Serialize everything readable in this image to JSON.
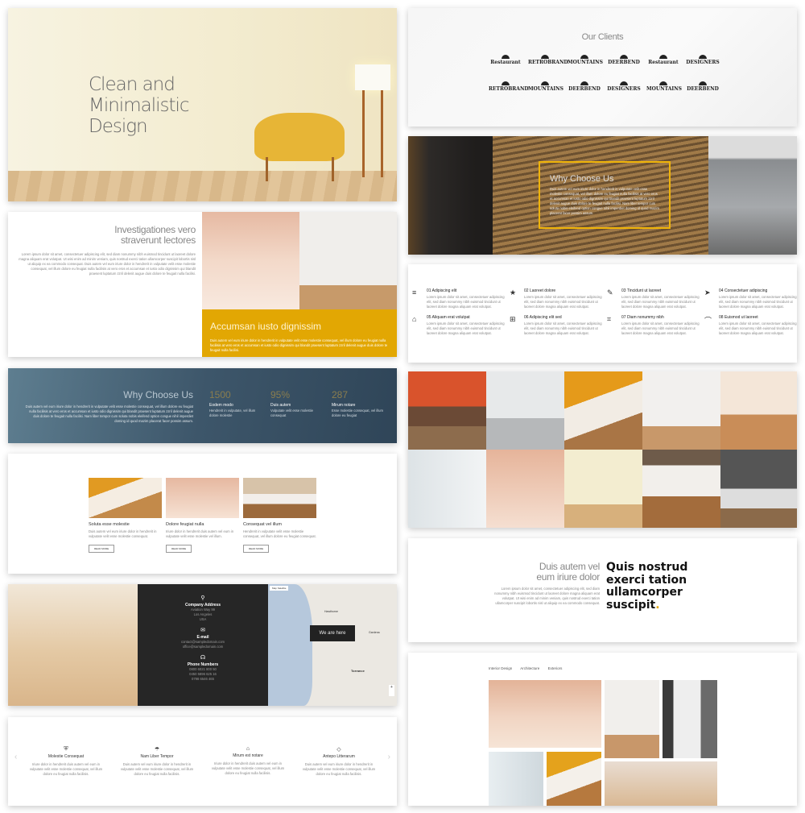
{
  "hero": {
    "title_lines": [
      "Clean and",
      "Minimalistic",
      "Design"
    ]
  },
  "split": {
    "title_lines": [
      "Investigationes vero",
      "straverunt lectores"
    ],
    "text": "Lorem ipsum dolor sit amet, consectetuer adipiscing elit, sed diam nonummy nibh euismod tincidunt ut laoreet dolore magna aliquam erat volutpat. Ut wisi enim ad minim veniam, quis nostrud exerci tation ullamcorper suscipit lobortis nisl ut aliquip ex ea commodo consequat. Duis autem vel eum iriure dolor in hendrerit in vulputate velit esse molestie consequat, vel illum dolore eu feugiat nulla facilisis at vero eros et accumsan et iusto odio dignissim qui blandit praesent luptatum zzril delenit augue duis dolore te feugait nulla facilisi.",
    "yellow_title": "Accumsan iusto dignissim",
    "yellow_text": "Duis autem vel eum iriure dolor in hendrerit in vulputate velit esse molestie consequat, vel illum dolore eu feugiat nulla facilisis at vero eros et accumsan et iusto odio dignissim qui blandit praesent luptatum zzril delenit augue duis dolore te feugait nulla facilisi.",
    "accent": "#e2a703"
  },
  "why_blue": {
    "title": "Why Choose Us",
    "text": "Duis autem vel eum iriure dolor in hendrerit in vulputate velit esse molestie consequat, vel illum dolore eu feugiat nulla facilisis at vero eros et accumsan et iusto odio dignissim qui blandit praesent luptatum zzril delenit augue duis dolore te feugait nulla facilisi. Nam liber tempor cum soluta nobis eleifend option congue nihil imperdiet doming id quod mazim placerat facer possim assum.",
    "stats": [
      {
        "number": "1500",
        "title": "Eodem modo",
        "text": "Hendrerit in vulputate, vel illum dolore molestie"
      },
      {
        "number": "95%",
        "title": "Duis autem",
        "text": "Vulputate velit esse molestie consequat"
      },
      {
        "number": "287",
        "title": "Mirum notare",
        "text": "Esse molestie consequat, vel illum dolore eu feugiat"
      }
    ]
  },
  "cards": {
    "button_label": "READ MORE",
    "items": [
      {
        "title": "Soluta esse molestie",
        "text": "Duis autem vel eum iriure dolor in hendrerit in vulputate velit esse molestie consequat."
      },
      {
        "title": "Dolore feugiat nulla",
        "text": "Iriure dolor in hendrerit duis autem vel eum in vulputate velit esse molestie vel illum."
      },
      {
        "title": "Consequat vel illum",
        "text": "Hendrerit in vulputate velit esse molestie consequat, vel illum dolore eu feugiat consequat."
      }
    ]
  },
  "contact": {
    "address_title": "Company Address",
    "address_lines": [
      "Aviation Way 99",
      "Los Angeles",
      "USA"
    ],
    "email_title": "E-mail",
    "emails": [
      "contact@sampledomain.com",
      "office@sampledomain.com"
    ],
    "phone_title": "Phone Numbers",
    "phones": [
      "0800 6021 800 50",
      "0450 5896 625 16",
      "0798 6546 465"
    ],
    "map_tooltip": "We are here",
    "map_types": [
      "Map",
      "Satellite"
    ],
    "map_places": [
      "Torrance",
      "Gardena",
      "Hawthorne"
    ]
  },
  "services": {
    "items": [
      {
        "icon": "shield-icon",
        "title": "Molestie Consequat",
        "text": "Iriure dolor in hendrerit duis autem vel eum in vulputate velit esse molestie consequat, vel illum dolore eu feugiat nulla facilisis."
      },
      {
        "icon": "umbrella-icon",
        "title": "Nam Liber Tempor",
        "text": "Duis autem vel eum iriure dolor in hendrerit in vulputate velit esse molestie consequat, vel illum dolore eu feugiat nulla facilisis."
      },
      {
        "icon": "home-icon",
        "title": "Mirum est notare",
        "text": "Iriure dolor in hendrerit duis autem vel eum in vulputate velit esse molestie consequat, vel illum dolore eu feugiat nulla facilisis."
      },
      {
        "icon": "diamond-icon",
        "title": "Antepo Litterarum",
        "text": "Duis autem vel eum iriure dolor in hendrerit in vulputate velit esse molestie consequat, vel illum dolore eu feugiat nulla facilisis."
      }
    ]
  },
  "clients": {
    "title": "Our Clients",
    "logos": [
      "Restaurant",
      "RETROBRAND",
      "MOUNTAINS",
      "DEERBEND",
      "Restaurant",
      "DESIGNERS",
      "RETROBRAND",
      "MOUNTAINS",
      "DEERBEND",
      "DESIGNERS",
      "MOUNTAINS",
      "DEERBEND"
    ]
  },
  "why_box": {
    "title": "Why Choose Us",
    "text": "Duis autem vel eum iriure dolor in hendrerit in vulputate velit esse molestie consequat, vel illum dolore eu feugiat nulla facilisis at vero eros et accumsan et iusto odio dignissim qui blandit praesent luptatum zzril delenit augue duis dolore te feugait nulla facilisi. Nam liber tempor cum soluta nobis eleifend option congue nihil imperdiet doming id quod mazim placerat facer possim assum.",
    "border_color": "#efb40a"
  },
  "features": {
    "text": "Lorem ipsum dolor sit amet, consectetuer adipiscing elit, sed diam nonummy nibh euismod tincidunt ut laoreet dolore magna aliquam erat volutpat.",
    "items": [
      {
        "icon": "layers-icon",
        "title": "01 Adipiscing elit"
      },
      {
        "icon": "pin-icon",
        "title": "02 Laoreet dolore"
      },
      {
        "icon": "pencil-icon",
        "title": "03 Tincidunt ut laoreet"
      },
      {
        "icon": "paper-plane-icon",
        "title": "04 Consectetuer adipiscing"
      },
      {
        "icon": "home-icon",
        "title": "05 Aliquam erat volutpat"
      },
      {
        "icon": "grid-icon",
        "title": "06 Adipiscing elit sed"
      },
      {
        "icon": "crop-icon",
        "title": "07 Diam nonummy nibh"
      },
      {
        "icon": "bezier-icon",
        "title": "08 Euismod ut laoreet"
      }
    ]
  },
  "quote": {
    "title_lines": [
      "Duis autem vel",
      "eum iriure dolor"
    ],
    "text": "Lorem ipsum dolor sit amet, consectetuer adipiscing elit, sed diam nonummy nibh euismod tincidunt ut laoreet dolore magna aliquam erat volutpat. Ut wisi enim ad minim veniam, quis nostrud exerci tation ullamcorper suscipit lobortis nisl ut aliquip ex ea commodo consequat.",
    "headline_lines": [
      "Quis nostrud",
      "exerci tation",
      "ullamcorper",
      "suscipit"
    ],
    "headline_end": "."
  },
  "portfolio": {
    "tabs": [
      "Interior Design",
      "Architecture",
      "Exteriors"
    ]
  }
}
